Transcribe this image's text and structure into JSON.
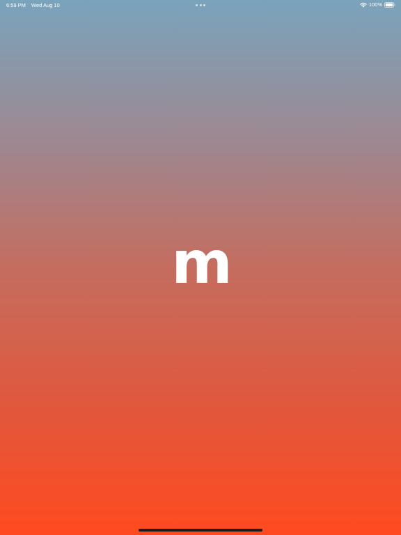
{
  "status_bar": {
    "time": "6:59 PM",
    "date": "Wed Aug 10",
    "battery_percent": "100%",
    "icons": [
      "wifi-icon",
      "battery-icon"
    ]
  },
  "splash": {
    "logo_text": "m"
  },
  "colors": {
    "gradient_top": "#7aa3bc",
    "gradient_mid": "#c46d5f",
    "gradient_bottom": "#ff4a1f",
    "logo": "#ffffff",
    "home_indicator": "#1a1a1a"
  }
}
